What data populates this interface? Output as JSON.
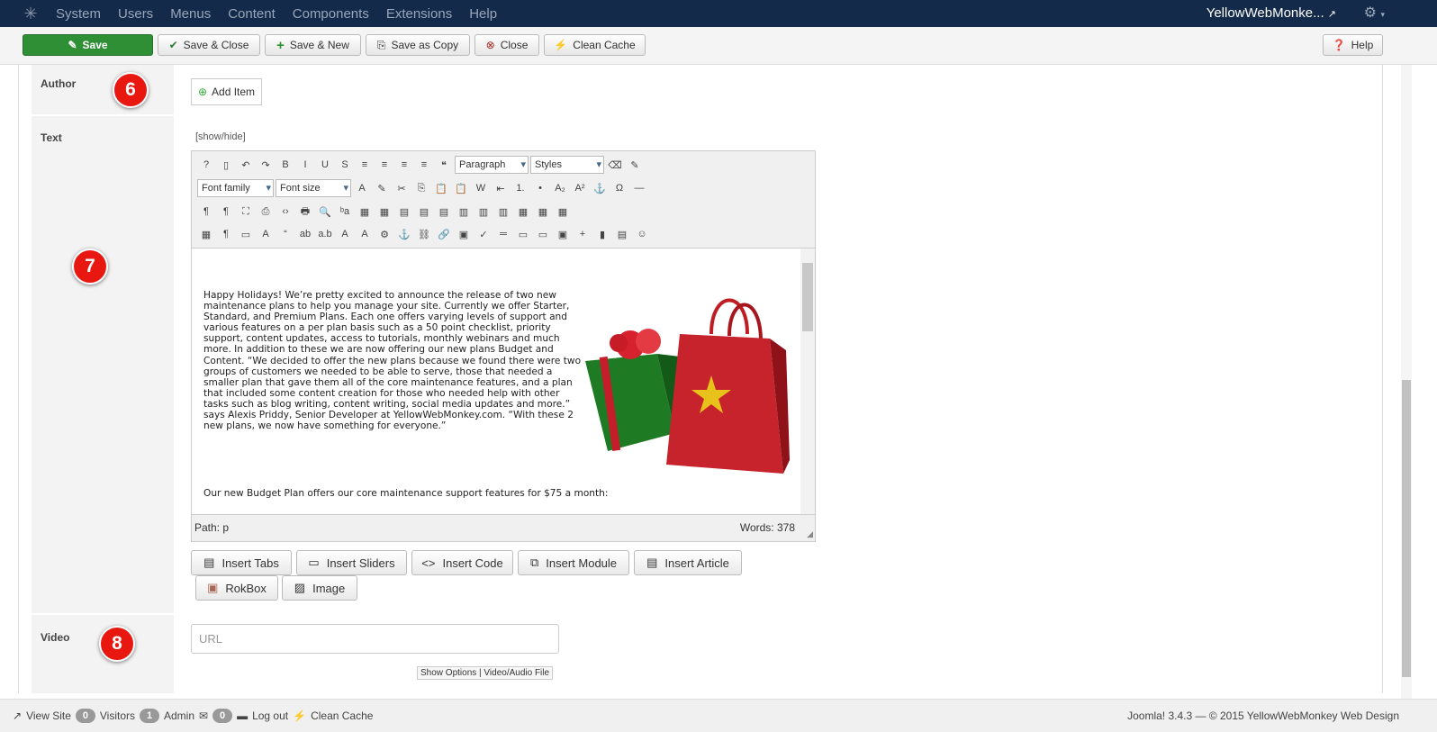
{
  "nav": {
    "menus": [
      "System",
      "Users",
      "Menus",
      "Content",
      "Components",
      "Extensions",
      "Help"
    ],
    "site": "YellowWebMonke...",
    "colors": {
      "bar": "#132a4a"
    }
  },
  "toolbar": {
    "save": "Save",
    "save_close": "Save & Close",
    "save_new": "Save & New",
    "save_copy": "Save as Copy",
    "close": "Close",
    "clean_cache": "Clean Cache",
    "help": "Help",
    "colors": {
      "save": "#2f8f35"
    }
  },
  "form": {
    "author_label": "Author",
    "add_item": "Add Item",
    "text_label": "Text",
    "show_hide": "[show/hide]",
    "video_label": "Video",
    "url_placeholder": "URL",
    "show_options": "Show Options",
    "video_file": "Video/Audio File",
    "badges": [
      "6",
      "7",
      "8"
    ]
  },
  "editor": {
    "paragraph": "Paragraph",
    "styles": "Styles",
    "font_family": "Font family",
    "font_size": "Font size",
    "row1_icons": [
      "help",
      "new-document",
      "undo",
      "redo",
      "bold",
      "italic",
      "underline",
      "strikethrough",
      "align-justify",
      "align-center",
      "align-left",
      "align-right",
      "blockquote"
    ],
    "row1_text": [
      "?",
      "▯",
      "↶",
      "↷",
      "B",
      "I",
      "U",
      "S",
      "≡",
      "≡",
      "≡",
      "≡",
      "❝"
    ],
    "row1_after": [
      "eraser",
      "clean-brush"
    ],
    "row1_after_text": [
      "⌫",
      "✎"
    ],
    "row2_icons": [
      "text-color",
      "highlight",
      "cut",
      "copy",
      "paste",
      "paste-text",
      "paste-word",
      "outdent",
      "numbered-list",
      "bullet-list",
      "subscript",
      "superscript",
      "anchor",
      "special-char",
      "horizontal-rule"
    ],
    "row2_text": [
      "A",
      "✎",
      "✂",
      "⎘",
      "📋",
      "📋",
      "W",
      "⇤",
      "1.",
      "•",
      "A₂",
      "A²",
      "⚓",
      "Ω",
      "—"
    ],
    "row3_icons": [
      "ltr",
      "rtl",
      "fullscreen",
      "preview",
      "source",
      "print",
      "find",
      "replace",
      "table",
      "delete-table",
      "row-before",
      "row-after",
      "delete-row",
      "col-before",
      "col-after",
      "delete-col",
      "split",
      "merge",
      "table-props"
    ],
    "row3_text": [
      "¶",
      "¶",
      "⛶",
      "⎙",
      "‹›",
      "🖶",
      "🔍",
      "ᵇa",
      "▦",
      "▦",
      "▤",
      "▤",
      "▤",
      "▥",
      "▥",
      "▥",
      "▦",
      "▦",
      "▦"
    ],
    "row4_icons": [
      "visual-aid",
      "show-blocks",
      "template",
      "styles",
      "cite",
      "abbr",
      "acronym",
      "del",
      "ins",
      "attributes",
      "anchor",
      "unlink",
      "link",
      "image",
      "spellcheck",
      "hr",
      "page-break",
      "media",
      "insert-image",
      "add-file",
      "video",
      "template2",
      "emotion"
    ],
    "row4_text": [
      "▦",
      "¶",
      "▭",
      "A",
      "“",
      "ab",
      "a.b",
      "A",
      "A",
      "⚙",
      "⚓",
      "⛓",
      "🔗",
      "▣",
      "✓",
      "═",
      "▭",
      "▭",
      "▣",
      "+",
      "▮",
      "▤",
      "☺"
    ],
    "paragraphs": [
      "Happy Holidays! We’re pretty excited to announce the release of two new maintenance plans to help you manage your site. Currently we offer Starter, Standard, and Premium Plans. Each one offers varying levels of support and various features on a per plan basis such as a 50 point checklist, priority support, content updates, access to tutorials, monthly webinars and much more. In addition to these we are now offering our new plans Budget and Content. “We decided to offer the new plans because we found there were two groups of customers we needed to be able to serve, those that needed a smaller plan that gave them all of the core maintenance features, and a plan that included some content creation for those who needed help with other tasks such as blog writing, content writing, social media updates and more.” says Alexis Priddy, Senior Developer at YellowWebMonkey.com. “With these 2 new plans, we now have something for everyone.”",
      "Our new Budget Plan offers our core maintenance support features for $75 a month:"
    ],
    "path": "Path:  p",
    "words": "Words: 378"
  },
  "insert": {
    "tabs": "Insert Tabs",
    "sliders": "Insert Sliders",
    "code": "Insert Code",
    "module": "Insert Module",
    "article": "Insert Article",
    "rokbox": "RokBox",
    "image": "Image"
  },
  "status": {
    "view_site": "View Site",
    "visitors_count": "0",
    "visitors": "Visitors",
    "admin_count": "1",
    "admin": "Admin",
    "messages_count": "0",
    "logout": "Log out",
    "clean_cache": "Clean Cache",
    "copyright": "Joomla! 3.4.3  —  © 2015 YellowWebMonkey Web Design"
  }
}
